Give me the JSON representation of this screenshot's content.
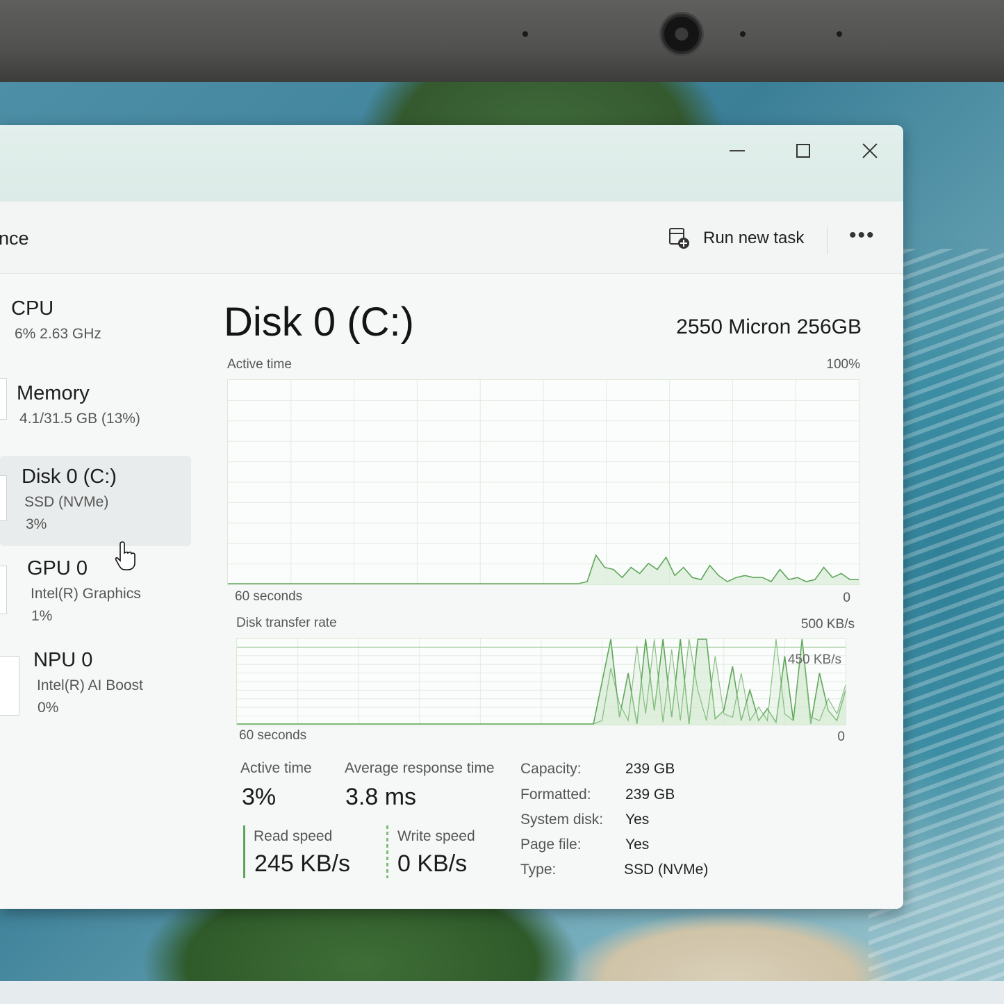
{
  "window": {
    "page_heading": "nce",
    "minimize_label": "",
    "run_new_task": "Run new task",
    "more_label": "•••"
  },
  "sidebar": {
    "items": [
      {
        "name": "CPU",
        "sub": "6%  2.63 GHz",
        "sub2": ""
      },
      {
        "name": "Memory",
        "sub": "4.1/31.5 GB (13%)",
        "sub2": ""
      },
      {
        "name": "Disk 0 (C:)",
        "sub": "SSD (NVMe)",
        "sub2": "3%"
      },
      {
        "name": "GPU 0",
        "sub": "Intel(R) Graphics",
        "sub2": "1%"
      },
      {
        "name": "NPU 0",
        "sub": "Intel(R) AI Boost",
        "sub2": "0%"
      }
    ]
  },
  "main": {
    "title": "Disk 0 (C:)",
    "model": "2550 Micron 256GB",
    "active_graph": {
      "label": "Active time",
      "max": "100%",
      "x_label": "60 seconds",
      "min": "0"
    },
    "transfer_graph": {
      "label": "Disk transfer rate",
      "max": "500 KB/s",
      "ref_line": "450 KB/s",
      "x_label": "60 seconds",
      "min": "0"
    },
    "stats": {
      "active_time_label": "Active time",
      "active_time_value": "3%",
      "avg_response_label": "Average response time",
      "avg_response_value": "3.8 ms",
      "read_label": "Read speed",
      "read_value": "245 KB/s",
      "write_label": "Write speed",
      "write_value": "0 KB/s"
    },
    "properties": [
      {
        "key": "Capacity:",
        "value": "239 GB"
      },
      {
        "key": "Formatted:",
        "value": "239 GB"
      },
      {
        "key": "System disk:",
        "value": "Yes"
      },
      {
        "key": "Page file:",
        "value": "Yes"
      },
      {
        "key": "Type:",
        "value": "SSD (NVMe)"
      }
    ]
  },
  "chart_data": [
    {
      "type": "area",
      "title": "Active time",
      "ylim": [
        0,
        100
      ],
      "y_unit": "%",
      "x_span": "60 seconds",
      "series": [
        {
          "values": [
            0,
            0,
            0,
            0,
            0,
            0,
            0,
            0,
            0,
            0,
            0,
            0,
            0,
            0,
            0,
            0,
            0,
            0,
            0,
            0,
            0,
            0,
            0,
            0,
            0,
            0,
            0,
            0,
            0,
            0,
            0,
            0,
            0,
            0,
            0,
            0,
            0,
            0,
            0,
            0,
            0,
            1,
            14,
            8,
            7,
            3,
            8,
            5,
            10,
            7,
            13,
            4,
            8,
            3,
            2,
            9,
            4,
            1,
            3,
            4,
            3,
            3,
            1,
            7,
            2,
            3,
            1,
            2,
            8,
            3,
            5,
            2,
            2
          ]
        }
      ]
    },
    {
      "type": "line",
      "title": "Disk transfer rate",
      "ylim": [
        0,
        500
      ],
      "y_unit": "KB/s",
      "x_span": "60 seconds",
      "series": [
        {
          "values": [
            0,
            0,
            0,
            0,
            0,
            0,
            0,
            0,
            0,
            0,
            0,
            0,
            0,
            0,
            0,
            0,
            0,
            0,
            0,
            0,
            0,
            0,
            0,
            0,
            0,
            0,
            0,
            0,
            0,
            0,
            0,
            0,
            0,
            0,
            0,
            0,
            0,
            0,
            0,
            0,
            0,
            0,
            250,
            500,
            40,
            300,
            0,
            500,
            80,
            500,
            40,
            500,
            0,
            500,
            500,
            30,
            80,
            340,
            20,
            200,
            20,
            90,
            10,
            400,
            20,
            500,
            0,
            300,
            80,
            20,
            200
          ]
        },
        {
          "values": [
            0,
            0,
            0,
            0,
            0,
            0,
            0,
            0,
            0,
            0,
            0,
            0,
            0,
            0,
            0,
            0,
            0,
            0,
            0,
            0,
            0,
            0,
            0,
            0,
            0,
            0,
            0,
            0,
            0,
            0,
            0,
            0,
            0,
            0,
            0,
            0,
            0,
            0,
            0,
            0,
            0,
            0,
            20,
            330,
            120,
            20,
            460,
            60,
            500,
            10,
            440,
            20,
            500,
            200,
            20,
            400,
            60,
            40,
            300,
            20,
            100,
            20,
            500,
            60,
            20,
            500,
            40,
            20,
            150,
            60,
            230
          ]
        }
      ]
    }
  ],
  "colors": {
    "graph_line": "#5fa65a",
    "graph_fill": "#d4ead0",
    "grid": "#e3ece1"
  }
}
